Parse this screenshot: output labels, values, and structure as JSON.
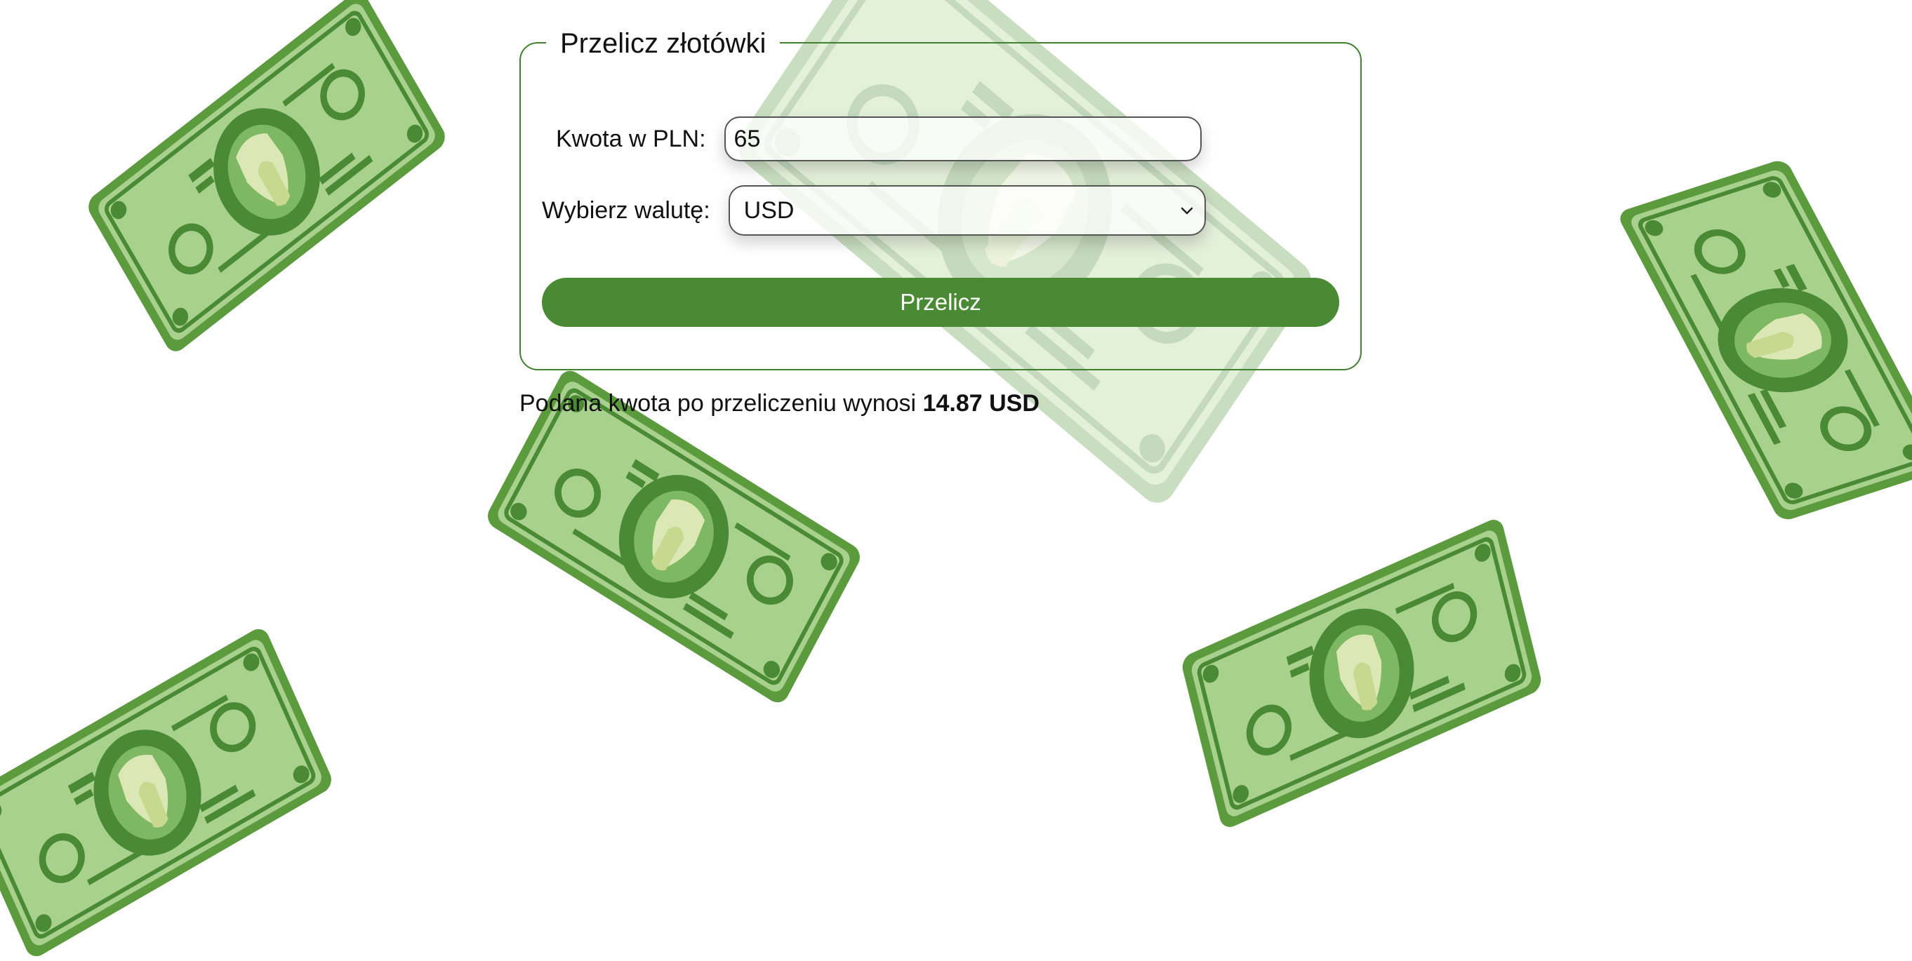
{
  "form": {
    "legend": "Przelicz złotówki",
    "amount_label": "Kwota w PLN:",
    "amount_value": "65",
    "currency_label": "Wybierz walutę:",
    "currency_selected": "USD",
    "submit_label": "Przelicz"
  },
  "result": {
    "prefix": "Podana kwota po przeliczeniu wynosi",
    "value": "14.87 USD"
  },
  "colors": {
    "accent": "#4a8a35",
    "border": "#3f7f2f",
    "bill_dark": "#5b9a3d",
    "bill_light": "#a9d18e"
  },
  "icons": {
    "background_bill": "dollar-bill-icon",
    "select_chevron": "chevron-down-icon"
  }
}
